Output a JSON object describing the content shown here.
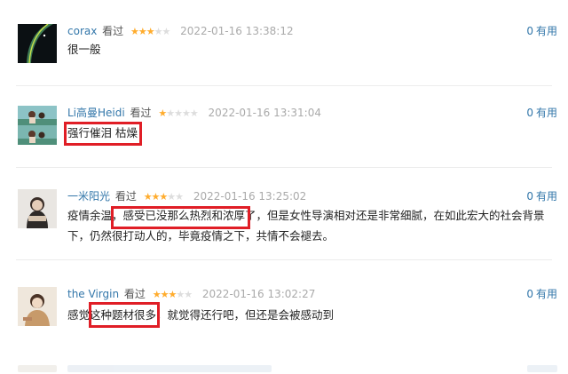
{
  "colors": {
    "link": "#3377aa",
    "star": "#ffac2d",
    "highlight": "#e01e26",
    "time": "#aaaaaa"
  },
  "vote_label": "有用",
  "seen_label": "看过",
  "comments": [
    {
      "user": "corax",
      "rating": 3,
      "time": "2022-01-16 13:38:12",
      "votes": "0",
      "text": "很一般",
      "avatar_icon": "night-horizon-avatar"
    },
    {
      "user": "Li高曼Heidi",
      "rating": 1,
      "time": "2022-01-16 13:31:04",
      "votes": "0",
      "text": "强行催泪 枯燥",
      "avatar_icon": "couple-photo-avatar"
    },
    {
      "user": "一米阳光",
      "rating": 3,
      "time": "2022-01-16 13:25:02",
      "votes": "0",
      "text": "疫情余温，感受已没那么热烈和浓厚了，但是女性导演相对还是非常细腻，在如此宏大的社会背景下，仍然很打动人的，毕竟疫情之下，共情不会褪去。",
      "avatar_icon": "portrait-avatar"
    },
    {
      "user": "the Virgin",
      "rating": 3,
      "time": "2022-01-16 13:02:27",
      "votes": "0",
      "text": "感觉这种题材很多，就觉得还行吧，但还是会被感动到",
      "avatar_icon": "woman-sitting-avatar"
    }
  ]
}
